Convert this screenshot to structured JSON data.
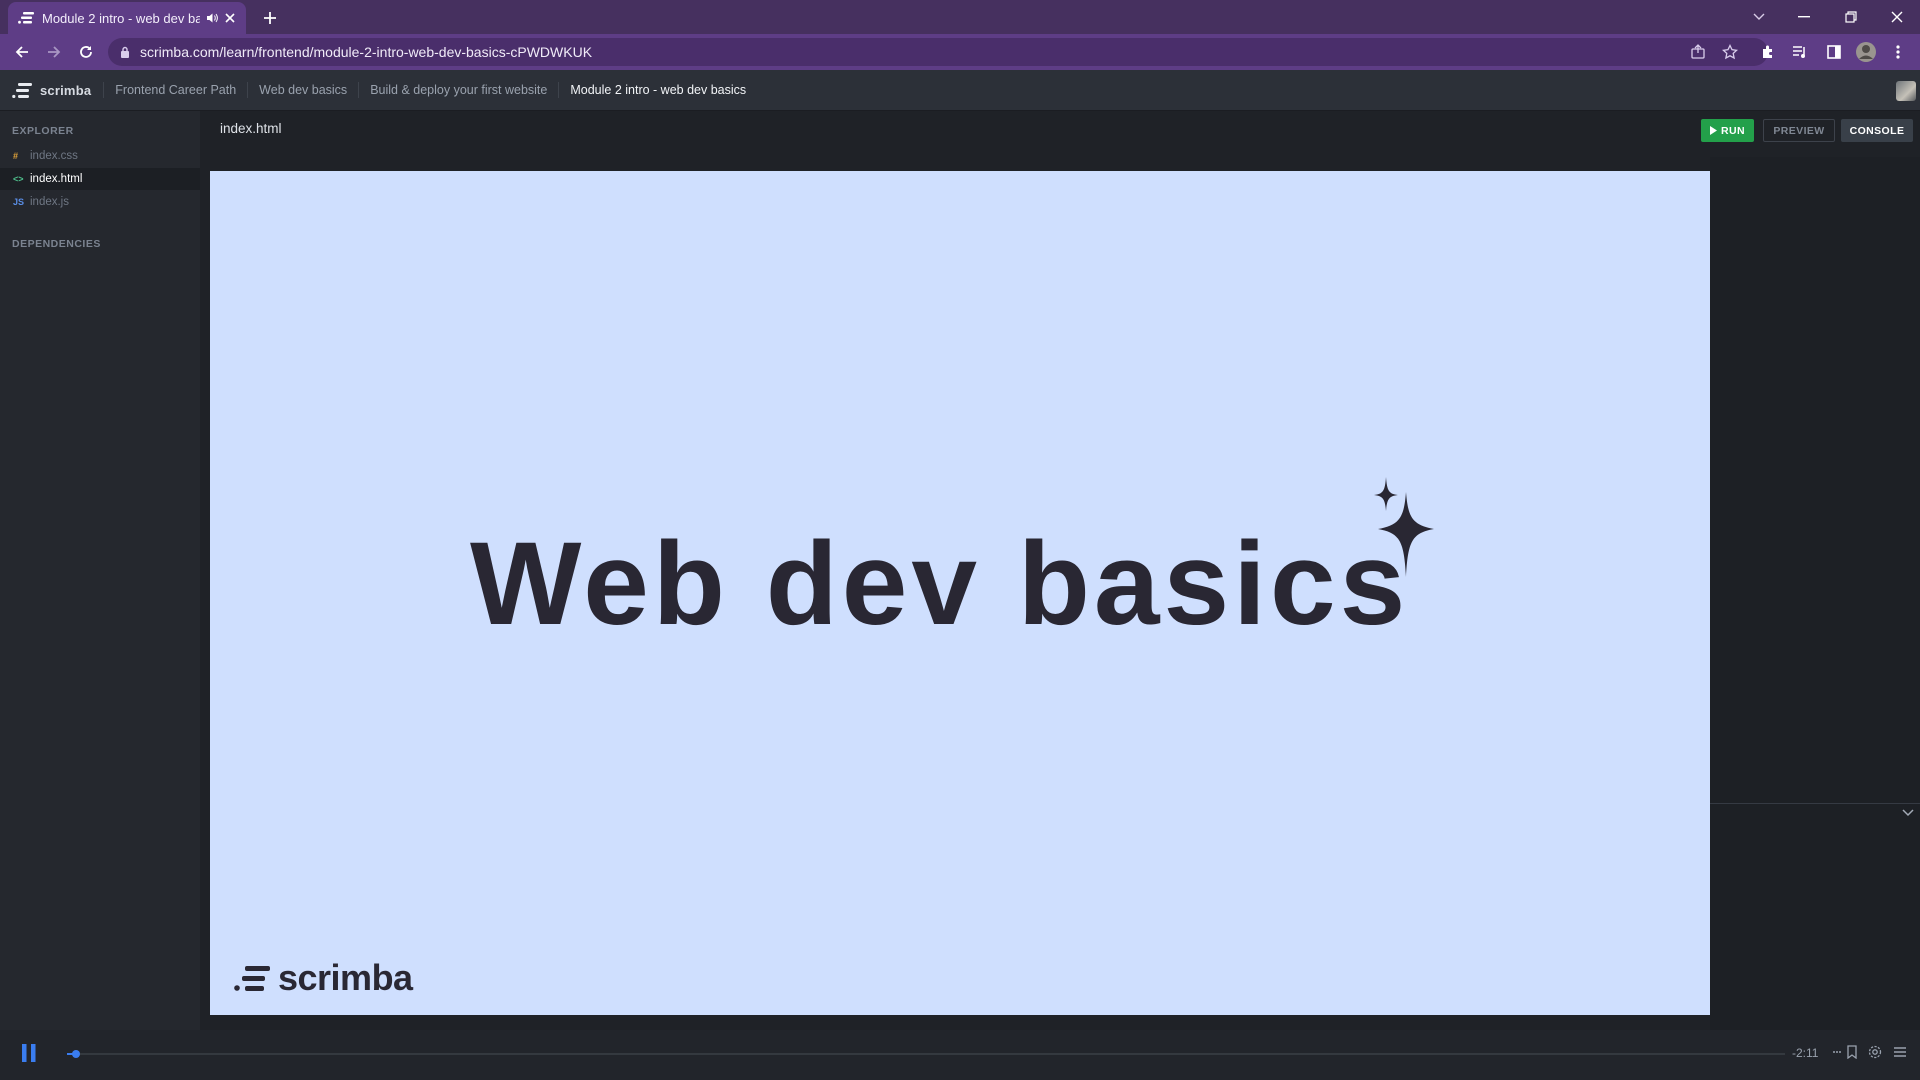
{
  "browser": {
    "tab_title": "Module 2 intro - web dev basics",
    "url": "scrimba.com/learn/frontend/module-2-intro-web-dev-basics-cPWDWKUK"
  },
  "scrimba": {
    "brand": "scrimba",
    "breadcrumbs": [
      "Frontend Career Path",
      "Web dev basics",
      "Build & deploy your first website",
      "Module 2 intro - web dev basics"
    ]
  },
  "sidebar": {
    "explorer_label": "EXPLORER",
    "files": [
      {
        "icon": "#",
        "name": "index.css",
        "icon_color": "#e0a33a"
      },
      {
        "icon": "<>",
        "name": "index.html",
        "icon_color": "#4fc08d"
      },
      {
        "icon": "JS",
        "name": "index.js",
        "icon_color": "#5a8ee6"
      }
    ],
    "dependencies_label": "DEPENDENCIES"
  },
  "editor": {
    "title": "index.html",
    "run_label": "RUN",
    "preview_label": "PREVIEW",
    "console_label": "CONSOLE"
  },
  "slide": {
    "title": "Web dev basics",
    "logo_text": "scrimba",
    "bg_color": "#cfdffe"
  },
  "player": {
    "time_remaining": "-2:11",
    "progress": 0.005
  },
  "colors": {
    "titlebar": "#46305f",
    "toolbar": "#5e3d86",
    "run_green": "#23a04a",
    "accent_blue": "#3a7df0"
  }
}
